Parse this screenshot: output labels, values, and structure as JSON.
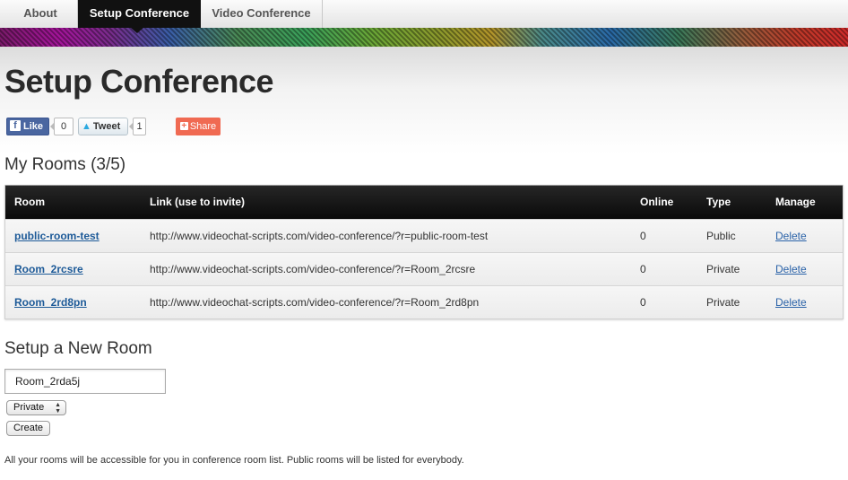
{
  "nav": {
    "tabs": [
      {
        "label": "About"
      },
      {
        "label": "Setup Conference"
      },
      {
        "label": "Video Conference"
      }
    ]
  },
  "page_title": "Setup Conference",
  "social": {
    "like_label": "Like",
    "like_count": "0",
    "tweet_label": "Tweet",
    "tweet_count": "1",
    "share_label": "Share"
  },
  "rooms": {
    "heading": "My Rooms (3/5)",
    "columns": {
      "room": "Room",
      "link": "Link (use to invite)",
      "online": "Online",
      "type": "Type",
      "manage": "Manage"
    },
    "rows": [
      {
        "room": "public-room-test",
        "link": "http://www.videochat-scripts.com/video-conference/?r=public-room-test",
        "online": "0",
        "type": "Public",
        "manage": "Delete"
      },
      {
        "room": "Room_2rcsre",
        "link": "http://www.videochat-scripts.com/video-conference/?r=Room_2rcsre",
        "online": "0",
        "type": "Private",
        "manage": "Delete"
      },
      {
        "room": "Room_2rd8pn",
        "link": "http://www.videochat-scripts.com/video-conference/?r=Room_2rd8pn",
        "online": "0",
        "type": "Private",
        "manage": "Delete"
      }
    ]
  },
  "new_room": {
    "heading": "Setup a New Room",
    "name_value": "Room_2rda5j",
    "type_selected": "Private",
    "create_label": "Create"
  },
  "note": "All your rooms will be accessible for you in conference room list. Public rooms will be listed for everybody.",
  "colors": {
    "active_tab": "#111111",
    "link": "#1d5a98",
    "fb": "#4a66a0",
    "share": "#f06a52"
  }
}
